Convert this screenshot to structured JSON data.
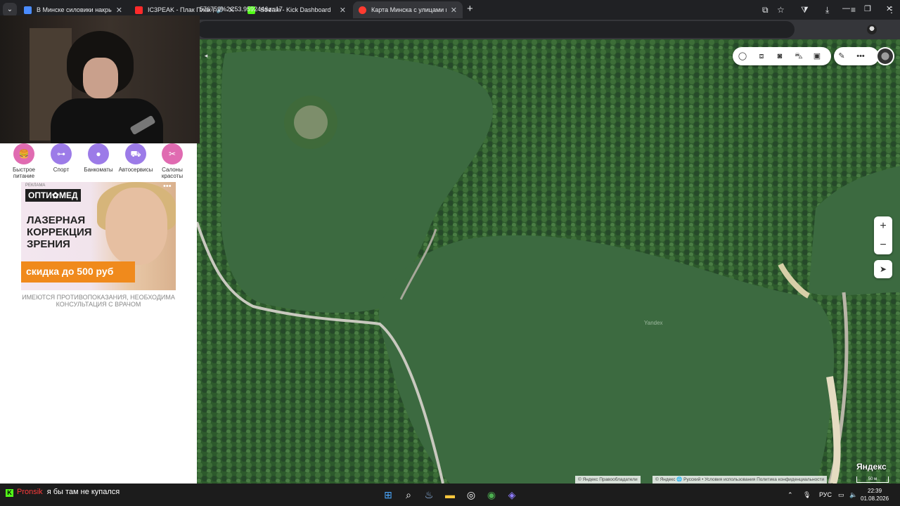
{
  "browser": {
    "tabs": [
      {
        "title": "В Минске силовики накрыли",
        "favicon_color": "#4a8cff",
        "active": false
      },
      {
        "title": "IC3PEAK - Плак Плак (R Dub",
        "favicon_color": "#ff2a2a",
        "active": false
      },
      {
        "title": "Stream - Kick Dashboard",
        "favicon_color": "#53fc18",
        "active": false
      },
      {
        "title": "Карта Минска с улицами и но",
        "favicon_color": "#ff3b30",
        "active": true
      }
    ],
    "url": "576759%2C53.959244&z=17"
  },
  "sidebar": {
    "categories": [
      {
        "label": "Быстрое питание",
        "icon": "burger-icon",
        "glyph": "🍔",
        "color": "#e06bb1"
      },
      {
        "label": "Спорт",
        "icon": "dumbbell-icon",
        "glyph": "⊶",
        "color": "#9c7be8"
      },
      {
        "label": "Банкоматы",
        "icon": "coins-icon",
        "glyph": "●",
        "color": "#9c7be8"
      },
      {
        "label": "Автосервисы",
        "icon": "car-icon",
        "glyph": "⛟",
        "color": "#9c7be8"
      },
      {
        "label": "Салоны красоты",
        "icon": "scissors-icon",
        "glyph": "✂",
        "color": "#e06bb1"
      }
    ],
    "ad": {
      "tag": "РЕКЛАМА",
      "brand": "ОПТИ✿МЕД",
      "headline": "ЛАЗЕРНАЯ КОРРЕКЦИЯ ЗРЕНИЯ",
      "cta": "скидка до 500 руб",
      "more": "•••",
      "warning": "ИМЕЮТСЯ ПРОТИВОПОКАЗАНИЯ, НЕОБХОДИМА КОНСУЛЬТАЦИЯ С ВРАЧОМ"
    }
  },
  "map": {
    "watermark": "Yandex",
    "logo": "Яндекс",
    "scale": "50 м",
    "copyright_left": "© Яндекс   Правообладатели",
    "copyright_right": "© Яндекс   🌐 Русский •   Условия использования   Политика конфиденциальности",
    "zoom_in": "+",
    "zoom_out": "−"
  },
  "chat": {
    "nick": "Pronsik",
    "message": "я бы там не купался"
  },
  "taskbar": {
    "language": "РУС",
    "time": "22:39",
    "date": "01.08.2026"
  }
}
